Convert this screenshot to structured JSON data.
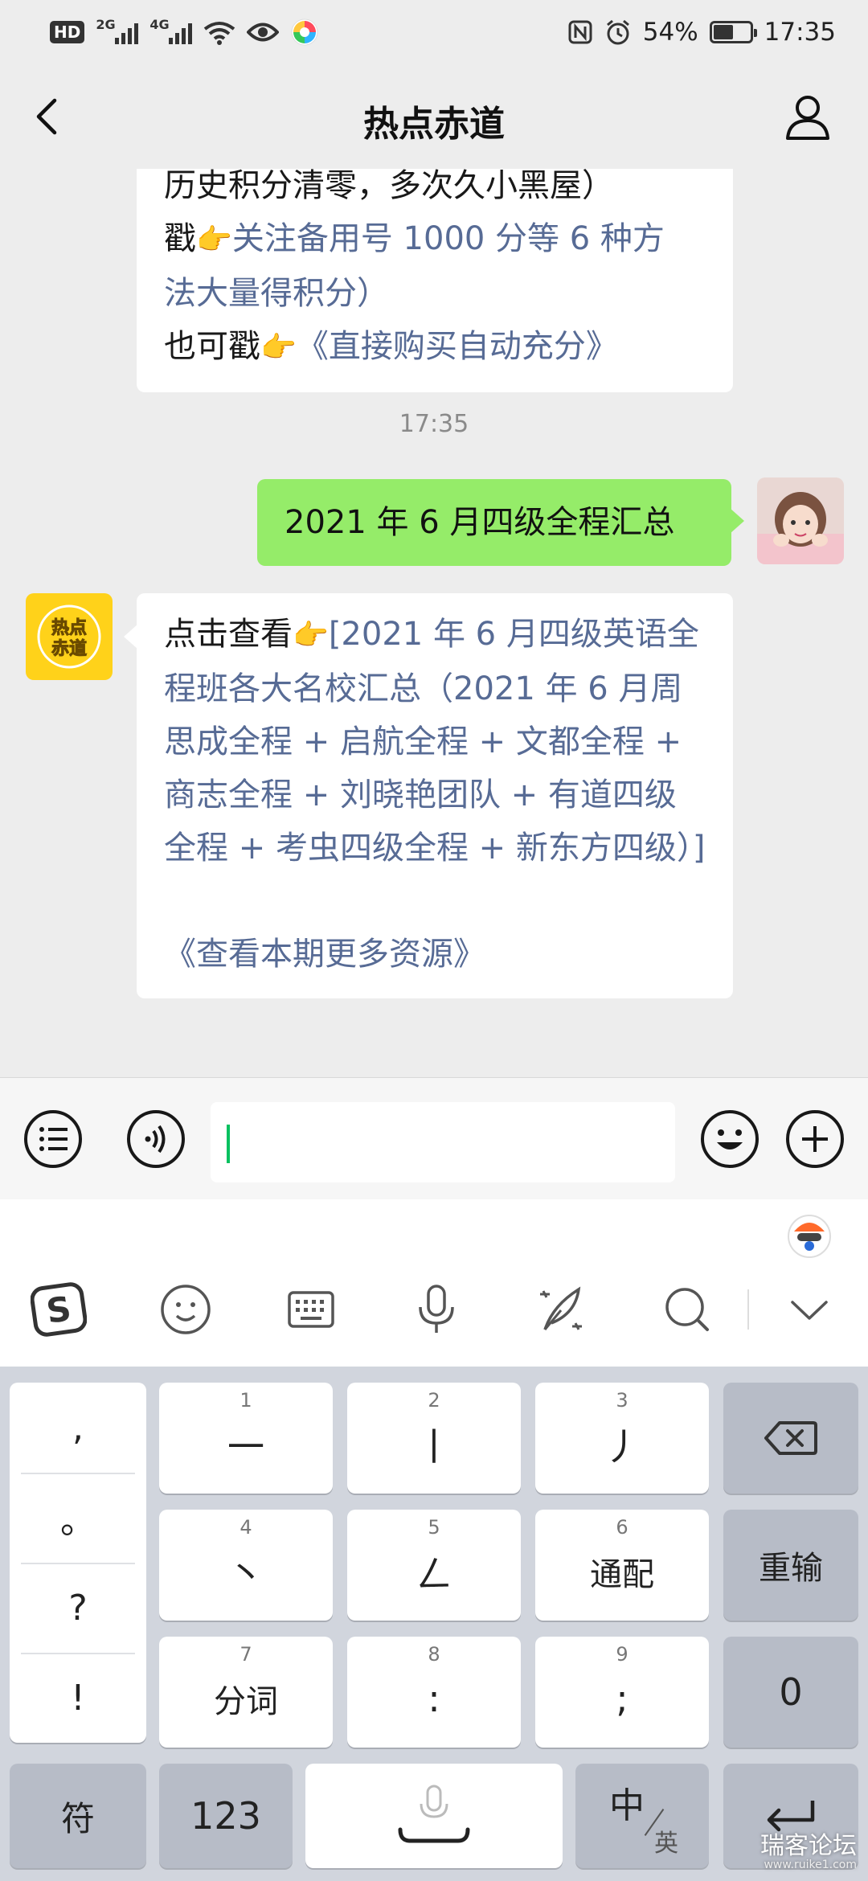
{
  "status_bar": {
    "hd_label": "HD",
    "signal_1": "2G",
    "signal_2": "4G",
    "battery_text": "54%",
    "battery_level": 0.54,
    "time": "17:35"
  },
  "nav": {
    "title": "热点赤道"
  },
  "chat": {
    "bubble1": {
      "line_clipped": "历史积分清零，多次久小黑屋）",
      "line2_prefix": "戳",
      "line2_link": "关注备用号 1000 分等 6 种方",
      "line3": "法大量得积分）",
      "line4_prefix": "也可戳",
      "line4_link": "《直接购买自动充分》"
    },
    "timestamp": "17:35",
    "outgoing": "2021 年 6 月四级全程汇总",
    "bot_avatar_text": "热点赤道",
    "bubble2": {
      "prefix": "点击查看",
      "link": "[2021 年 6 月四级英语全程班各大名校汇总（2021 年 6 月周思成全程 + 启航全程 + 文都全程 + 商志全程 + 刘晓艳团队 + 有道四级全程 + 考虫四级全程 + 新东方四级）]",
      "more": "《查看本期更多资源》"
    }
  },
  "input_bar": {
    "text_value": ""
  },
  "keyboard": {
    "punct": [
      ",",
      "。",
      "?",
      "!"
    ],
    "keys": [
      {
        "num": "1",
        "label": "一"
      },
      {
        "num": "2",
        "label": "丨"
      },
      {
        "num": "3",
        "label": "丿"
      },
      {
        "num": "4",
        "label": "丶"
      },
      {
        "num": "5",
        "label": "ㄥ"
      },
      {
        "num": "6",
        "label": "通配"
      },
      {
        "num": "7",
        "label": "分词"
      },
      {
        "num": "8",
        "label": ":"
      },
      {
        "num": "9",
        "label": ";"
      }
    ],
    "retype_label": "重输",
    "zero_label": "0",
    "symbol_label": "符",
    "num_label": "123",
    "lang_main": "中",
    "lang_sub": "英"
  },
  "watermark": {
    "text": "瑞客论坛",
    "sub": "www.ruike1.com"
  },
  "colors": {
    "link": "#576b95",
    "outgoing_bubble": "#95ec69",
    "caret": "#07c160",
    "bot_avatar_bg": "#ffd21a"
  }
}
